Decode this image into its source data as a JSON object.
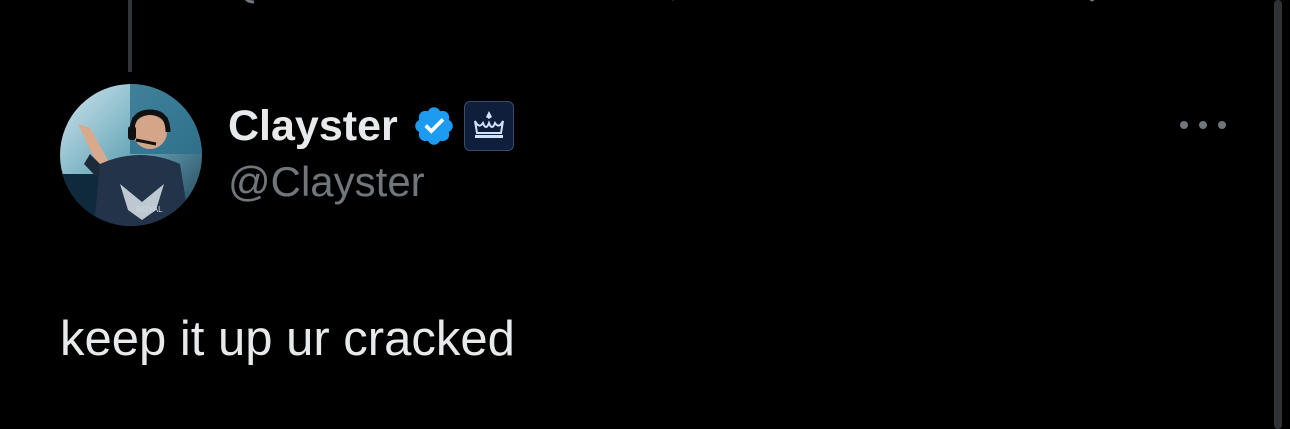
{
  "tweet": {
    "author": {
      "display_name": "Clayster",
      "handle": "@Clayster",
      "verified": true,
      "verified_color": "#1d9bf0",
      "affiliate_badge": "crown-badge-icon",
      "avatar": "profile-avatar"
    },
    "text": "keep it up ur cracked",
    "more_options": "more-options-icon"
  },
  "colors": {
    "background": "#000000",
    "text_primary": "#e7e9ea",
    "text_secondary": "#71767b",
    "accent": "#1d9bf0"
  }
}
